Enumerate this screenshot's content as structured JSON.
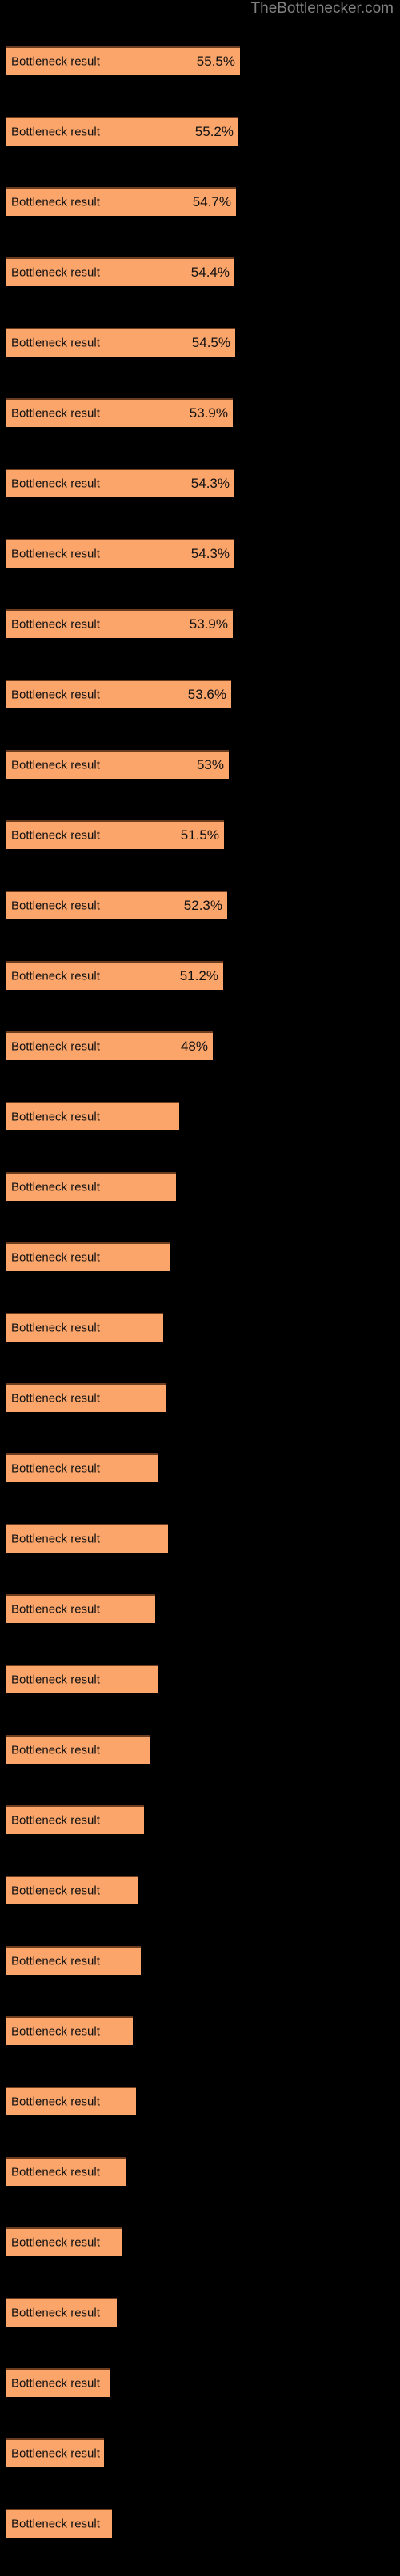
{
  "watermark": "TheBottlenecker.com",
  "colors": {
    "background": "#000000",
    "bar_fill": "#FCA56B",
    "bar_border": "#6B3C1E",
    "text": "#111111",
    "watermark": "#808080"
  },
  "chart_data": {
    "type": "bar",
    "orientation": "horizontal",
    "title": "",
    "subtitle": "",
    "xlabel": "",
    "ylabel": "",
    "grid": false,
    "legend": null,
    "xlim": [
      0,
      60
    ],
    "categories": [
      "Bottleneck result",
      "Bottleneck result",
      "Bottleneck result",
      "Bottleneck result",
      "Bottleneck result",
      "Bottleneck result",
      "Bottleneck result",
      "Bottleneck result",
      "Bottleneck result",
      "Bottleneck result",
      "Bottleneck result",
      "Bottleneck result",
      "Bottleneck result",
      "Bottleneck result",
      "Bottleneck result",
      "Bottleneck result",
      "Bottleneck result",
      "Bottleneck result",
      "Bottleneck result",
      "Bottleneck result",
      "Bottleneck result",
      "Bottleneck result",
      "Bottleneck result",
      "Bottleneck result",
      "Bottleneck result",
      "Bottleneck result",
      "Bottleneck result",
      "Bottleneck result",
      "Bottleneck result",
      "Bottleneck result",
      "Bottleneck result",
      "Bottleneck result",
      "Bottleneck result",
      "Bottleneck result",
      "Bottleneck result",
      "Bottleneck result"
    ],
    "values": [
      55.5,
      55.2,
      54.7,
      54.4,
      54.5,
      53.9,
      54.3,
      54.3,
      53.9,
      53.6,
      53.0,
      51.5,
      52.3,
      51.2,
      48.0,
      44.0,
      43.5,
      42.0,
      40.5,
      41.0,
      39.5,
      41.5,
      38.5,
      39.0,
      36.5,
      35.0,
      33.5,
      34.0,
      32.5,
      33.0,
      30.5,
      29.5,
      28.0,
      26.5,
      25.0,
      27.0
    ],
    "value_labels": [
      "55.5%",
      "55.2%",
      "54.7%",
      "54.4%",
      "54.5%",
      "53.9%",
      "54.3%",
      "54.3%",
      "53.9%",
      "53.6%",
      "53%",
      "51.5%",
      "52.3%",
      "51.2%",
      "48%",
      "",
      "",
      "",
      "",
      "",
      "",
      "",
      "",
      "",
      "",
      "",
      "",
      "",
      "",
      "",
      "",
      "",
      "",
      "",
      "",
      ""
    ],
    "bar_pixel_widths": [
      292,
      290,
      287,
      285,
      286,
      283,
      285,
      285,
      283,
      281,
      278,
      272,
      276,
      271,
      258,
      216,
      212,
      204,
      196,
      200,
      190,
      202,
      186,
      190,
      180,
      172,
      164,
      168,
      158,
      162,
      150,
      144,
      138,
      130,
      122,
      132
    ]
  }
}
